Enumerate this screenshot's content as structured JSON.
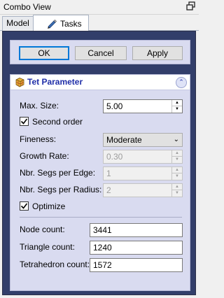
{
  "window": {
    "title": "Combo View",
    "float_icon": "float-icon"
  },
  "tabs": [
    {
      "label": "Model"
    },
    {
      "label": "Tasks",
      "icon": "pencil-icon"
    }
  ],
  "buttons": {
    "ok": "OK",
    "cancel": "Cancel",
    "apply": "Apply"
  },
  "panel": {
    "title": "Tet Parameter",
    "icon": "mesh-cube-icon",
    "collapse_icon": "collapse-chevron-icon",
    "max_size": {
      "label": "Max. Size:",
      "value": "5.00"
    },
    "second_order": {
      "label": "Second order",
      "checked": true
    },
    "fineness": {
      "label": "Fineness:",
      "value": "Moderate"
    },
    "growth_rate": {
      "label": "Growth Rate:",
      "value": "0.30"
    },
    "segs_per_edge": {
      "label": "Nbr. Segs per Edge:",
      "value": "1"
    },
    "segs_per_radius": {
      "label": "Nbr. Segs per Radius:",
      "value": "2"
    },
    "optimize": {
      "label": "Optimize",
      "checked": true
    },
    "node_count": {
      "label": "Node count:",
      "value": "3441"
    },
    "triangle_count": {
      "label": "Triangle count:",
      "value": "1240"
    },
    "tetrahedron_count": {
      "label": "Tetrahedron count:",
      "value": "1572"
    }
  },
  "colors": {
    "outer_bg": "#323e6a",
    "panel_bg": "#d9dbf0",
    "title_color": "#1f2ea8",
    "focus": "#0078d7"
  }
}
